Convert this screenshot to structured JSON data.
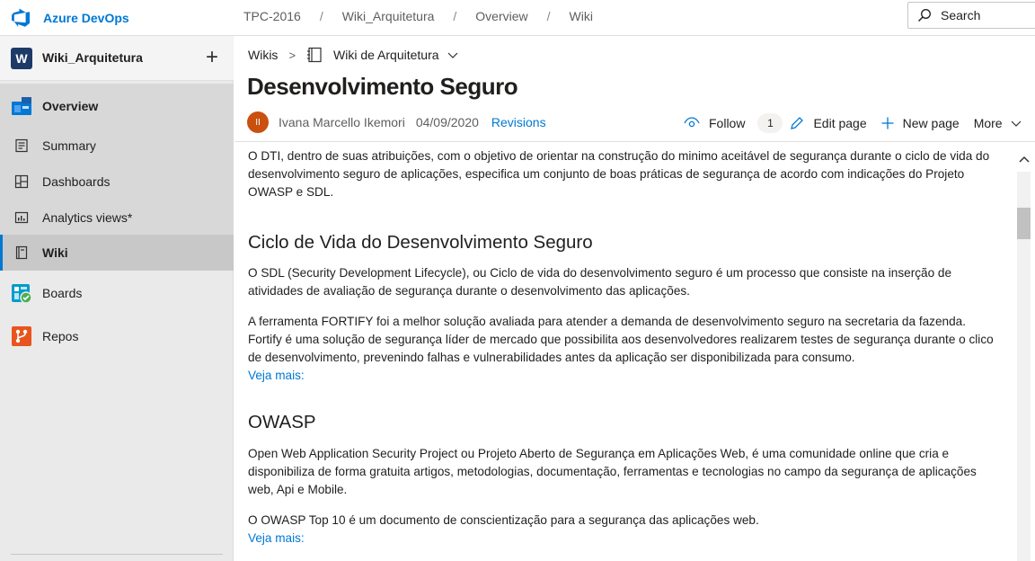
{
  "app": {
    "name": "Azure DevOps",
    "accent": "#0078d4"
  },
  "breadcrumb": [
    "TPC-2016",
    "Wiki_Arquitetura",
    "Overview",
    "Wiki"
  ],
  "search": {
    "placeholder": "Search"
  },
  "sidebar": {
    "project_initial": "W",
    "project_name": "Wiki_Arquitetura",
    "items": [
      {
        "label": "Overview",
        "icon": "overview-icon"
      },
      {
        "label": "Summary",
        "icon": "summary-icon"
      },
      {
        "label": "Dashboards",
        "icon": "dashboards-icon"
      },
      {
        "label": "Analytics views*",
        "icon": "analytics-icon"
      },
      {
        "label": "Wiki",
        "icon": "wiki-icon",
        "selected": true
      },
      {
        "label": "Boards",
        "icon": "boards-icon"
      },
      {
        "label": "Repos",
        "icon": "repos-icon"
      }
    ]
  },
  "wiki_header": {
    "root": "Wikis",
    "wiki_name": "Wiki de Arquitetura"
  },
  "page": {
    "title": "Desenvolvimento Seguro",
    "author_initials": "II",
    "author": "Ivana Marcello Ikemori",
    "date": "04/09/2020",
    "revisions": "Revisions",
    "follow": "Follow",
    "follow_count": "1",
    "edit": "Edit page",
    "new": "New page",
    "more": "More"
  },
  "content": {
    "intro": "O DTI, dentro de suas atribuições, com o objetivo de orientar na construção do minimo aceitável de segurança durante o ciclo de vida do desenvolvimento seguro de aplicações, especifica um conjunto de boas práticas de segurança de acordo com indicações do Projeto OWASP e SDL.",
    "h_ciclo": "Ciclo de Vida do Desenvolvimento Seguro",
    "p_sdl": "O SDL (Security Development Lifecycle), ou Ciclo de vida do desenvolvimento seguro é um processo que consiste na inserção de atividades de avaliação de segurança durante o desenvolvimento das aplicações.",
    "p_fortify": "A ferramenta FORTIFY foi a melhor solução avaliada para atender a demanda de desenvolvimento seguro na secretaria da fazenda. Fortify é uma solução de segurança líder de mercado que possibilita aos desenvolvedores realizarem testes de segurança durante o clico de desenvolvimento, prevenindo falhas e vulnerabilidades antes da aplicação ser disponibilizada para consumo.",
    "link_1": "Veja mais:",
    "h_owasp": "OWASP",
    "p_owasp": "Open Web Application Security Project ou Projeto Aberto de Segurança em Aplicações Web, é uma comunidade online que cria e disponibiliza de forma gratuita artigos, metodologias, documentação, ferramentas e tecnologias no campo da segurança de aplicações web, Api e Mobile.",
    "p_top10": "O OWASP Top 10 é um documento de conscientização para a segurança das aplicações web.",
    "link_2": "Veja mais:"
  }
}
